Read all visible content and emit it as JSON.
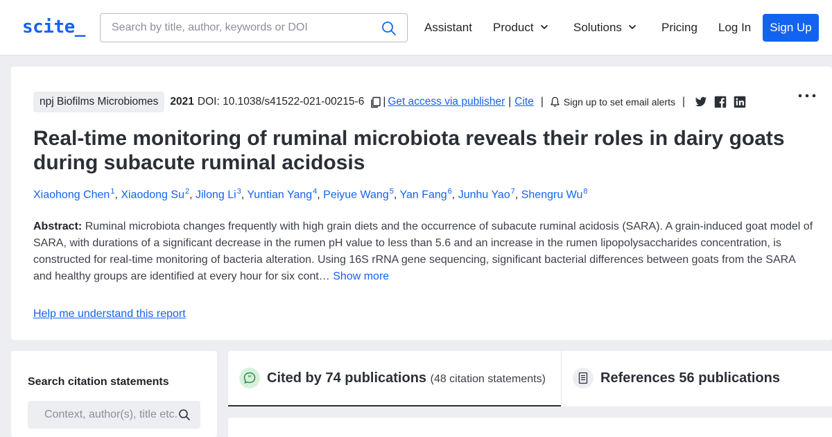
{
  "header": {
    "logo": "scite_",
    "search_placeholder": "Search by title, author, keywords or DOI",
    "nav": {
      "assistant": "Assistant",
      "product": "Product",
      "solutions": "Solutions",
      "pricing": "Pricing",
      "login": "Log In",
      "signup": "Sign Up"
    }
  },
  "article": {
    "journal": "npj Biofilms Microbiomes",
    "year": "2021",
    "doi": "DOI: 10.1038/s41522-021-00215-6",
    "separator": "|",
    "access_link": "Get access via publisher",
    "cite_link": "Cite",
    "alerts": "Sign up to set email alerts",
    "title": "Real-time monitoring of ruminal microbiota reveals their roles in dairy goats during subacute ruminal acidosis",
    "authors": [
      {
        "name": "Xiaohong Chen",
        "sup": "1"
      },
      {
        "name": "Xiaodong Su",
        "sup": "2"
      },
      {
        "name": "Jilong Li",
        "sup": "3"
      },
      {
        "name": "Yuntian Yang",
        "sup": "4"
      },
      {
        "name": "Peiyue Wang",
        "sup": "5"
      },
      {
        "name": "Yan Fang",
        "sup": "6"
      },
      {
        "name": "Junhu Yao",
        "sup": "7"
      },
      {
        "name": "Shengru Wu",
        "sup": "8"
      }
    ],
    "author_separator": ", ",
    "abstract_label": "Abstract:",
    "abstract_text": "Ruminal microbiota changes frequently with high grain diets and the occurrence of subacute ruminal acidosis (SARA). A grain-induced goat model of SARA, with durations of a significant decrease in the rumen pH value to less than 5.6 and an increase in the rumen lipopolysaccharides concentration, is constructed for real-time monitoring of bacteria alteration. Using 16S rRNA gene sequencing, significant bacterial differences between goats from the SARA and healthy groups are identified at every hour for six cont…",
    "show_more": "Show more",
    "help_link": "Help me understand this report"
  },
  "citation_search": {
    "heading": "Search citation statements",
    "placeholder": "Context, author(s), title etc."
  },
  "tabs": {
    "cited_by": "Cited by 74 publications",
    "cited_by_sub": "(48 citation statements)",
    "references": "References 56 publications"
  },
  "colors": {
    "brand_blue": "#1363f0",
    "cited_icon_bg": "#d7f0dc",
    "cited_icon_fg": "#2f8a47"
  }
}
